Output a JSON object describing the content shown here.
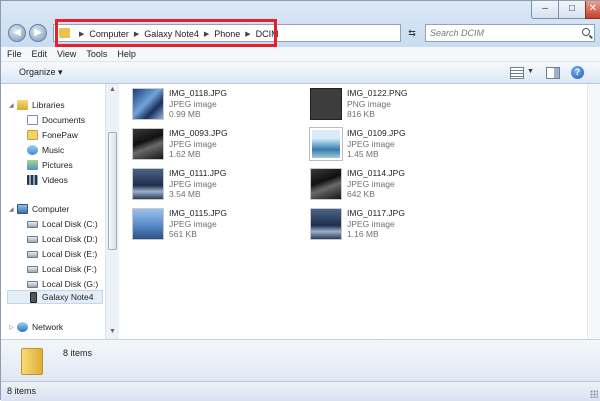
{
  "window": {
    "caption_min": "–",
    "caption_max": "□",
    "caption_close": "✕"
  },
  "address_bar": {
    "crumbs": [
      "Computer",
      "Galaxy Note4",
      "Phone",
      "DCIM"
    ]
  },
  "search": {
    "placeholder": "Search DCIM"
  },
  "menubar": {
    "items": [
      "File",
      "Edit",
      "View",
      "Tools",
      "Help"
    ]
  },
  "toolbar": {
    "organize_label": "Organize ▾"
  },
  "nav_pane": {
    "libraries": "Libraries",
    "library_items": [
      "Documents",
      "FonePaw",
      "Music",
      "Pictures",
      "Videos"
    ],
    "computer": "Computer",
    "computer_items": [
      "Local Disk (C:)",
      "Local Disk (D:)",
      "Local Disk (E:)",
      "Local Disk (F:)",
      "Local Disk (G:)",
      "Galaxy Note4"
    ],
    "network": "Network"
  },
  "files": [
    {
      "name": "IMG_0118.JPG",
      "type": "JPEG image",
      "size": "0.99 MB",
      "thumb": "blue"
    },
    {
      "name": "IMG_0122.PNG",
      "type": "PNG image",
      "size": "816 KB",
      "thumb": "png"
    },
    {
      "name": "IMG_0093.JPG",
      "type": "JPEG image",
      "size": "1.62 MB",
      "thumb": "dark"
    },
    {
      "name": "IMG_0109.JPG",
      "type": "JPEG image",
      "size": "1.45 MB",
      "thumb": "land"
    },
    {
      "name": "IMG_0111.JPG",
      "type": "JPEG image",
      "size": "3.54 MB",
      "thumb": "stormy"
    },
    {
      "name": "IMG_0114.JPG",
      "type": "JPEG image",
      "size": "642 KB",
      "thumb": "dark"
    },
    {
      "name": "IMG_0115.JPG",
      "type": "JPEG image",
      "size": "561 KB",
      "thumb": "sky"
    },
    {
      "name": "IMG_0117.JPG",
      "type": "JPEG image",
      "size": "1.16 MB",
      "thumb": "stormy"
    }
  ],
  "details_pane": {
    "item_count": "8 items"
  },
  "status_bar": {
    "item_count": "8 items"
  },
  "highlight_color": "#e6212b"
}
